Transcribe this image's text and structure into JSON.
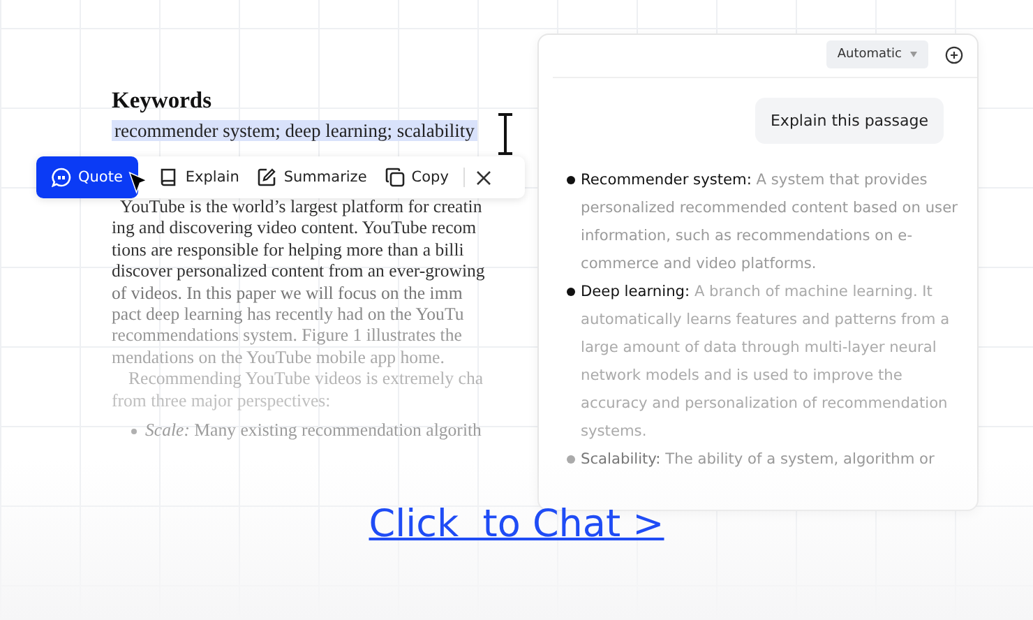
{
  "document": {
    "heading": "Keywords",
    "selected_text": "recommender system; deep learning; scalability",
    "paragraph_lines": [
      "YouTube is the world’s largest platform for creatin",
      "ing and discovering video content.  YouTube recom",
      "tions are responsible for helping more than a billi",
      "discover personalized content from an ever-growing",
      "of videos.  In this paper we will focus on the imm",
      "pact deep learning has recently had on the YouTu",
      "recommendations system.  Figure 1 illustrates the",
      "mendations on the YouTube mobile app home.",
      "Recommending YouTube videos is extremely cha",
      "from three major perspectives:"
    ],
    "bullet": "*Scale:* Many existing recommendation algorith"
  },
  "selection_toolbar": {
    "buttons": [
      {
        "kind": "quote",
        "label": "Quote",
        "selected": true
      },
      {
        "kind": "explain",
        "label": "Explain",
        "selected": false
      },
      {
        "kind": "summarize",
        "label": "Summarize",
        "selected": false
      },
      {
        "kind": "copy",
        "label": "Copy",
        "selected": false
      }
    ]
  },
  "chat_panel": {
    "model_select": "Automatic",
    "user_message": "Explain this passage",
    "answer": [
      {
        "text": "**Recommender system:** A system that provides personalized recommended content based on user information, such as recommendations on e-commerce and video platforms."
      },
      {
        "text": "**Deep learning:** A branch of machine learning. It automatically learns features and patterns from a large amount of data through multi-layer neural network models and is used to improve the accuracy and personalization of recommendation systems."
      },
      {
        "text": "**Scalability:** The ability of a system, algorithm or"
      }
    ]
  },
  "cta": "Click  to Chat >"
}
